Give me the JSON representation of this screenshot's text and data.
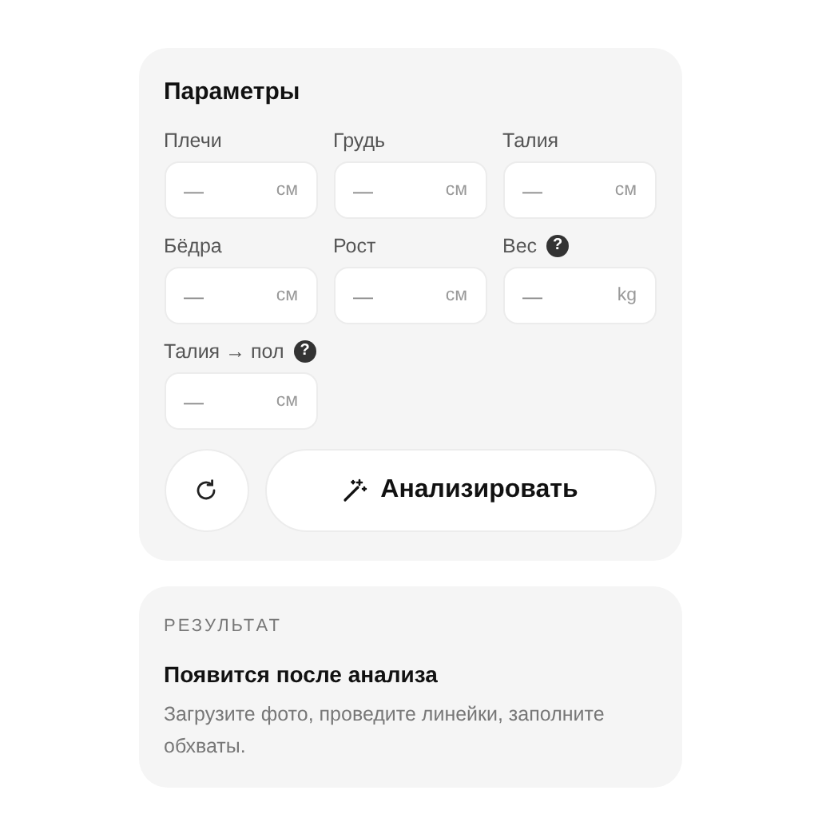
{
  "parameters": {
    "title": "Параметры",
    "fields": [
      {
        "label": "Плечи",
        "placeholder": "—",
        "unit": "см"
      },
      {
        "label": "Грудь",
        "placeholder": "—",
        "unit": "см"
      },
      {
        "label": "Талия",
        "placeholder": "—",
        "unit": "см"
      },
      {
        "label": "Бёдра",
        "placeholder": "—",
        "unit": "см"
      },
      {
        "label": "Рост",
        "placeholder": "—",
        "unit": "см"
      },
      {
        "label": "Вес",
        "help": "?",
        "placeholder": "—",
        "unit": "kg"
      },
      {
        "label": "Талия → пол",
        "help": "?",
        "placeholder": "—",
        "unit": "см"
      }
    ],
    "analyze_button": "Анализировать"
  },
  "result": {
    "heading": "РЕЗУЛЬТАТ",
    "title": "Появится после анализа",
    "description": "Загрузите фото, проведите линейки, заполните обхваты."
  }
}
